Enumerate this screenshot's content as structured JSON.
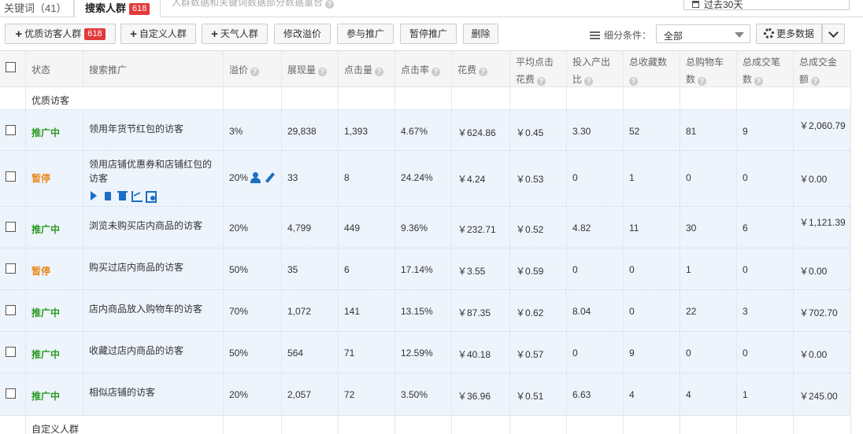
{
  "tabs": {
    "keywords": "关键词（41）",
    "crowd": "搜索人群",
    "crowd_badge": "618",
    "note": "人群数据和关键词数据部分数据重合",
    "date_range": "过去30天"
  },
  "toolbar": {
    "btn_quality": "优质访客人群",
    "btn_quality_badge": "618",
    "btn_custom": "自定义人群",
    "btn_weather": "天气人群",
    "btn_modify_premium": "修改溢价",
    "btn_join": "参与推广",
    "btn_pause": "暂停推广",
    "btn_delete": "删除",
    "filter_label": "细分条件：",
    "filter_value": "全部",
    "more_data": "更多数据"
  },
  "headers": {
    "status": "状态",
    "name": "搜索推广",
    "premium": "溢价",
    "impressions": "展现量",
    "clicks": "点击量",
    "ctr": "点击率",
    "cost": "花费",
    "avg_cpc_1": "平均点击",
    "avg_cpc_2": "花费",
    "roi_1": "投入产出",
    "roi_2": "比",
    "fav_1": "总收藏数",
    "cart_1": "总购物车",
    "cart_2": "数",
    "deals_1": "总成交笔",
    "deals_2": "数",
    "amount_1": "总成交金",
    "amount_2": "额"
  },
  "groups": {
    "quality": "优质访客",
    "custom": "自定义人群"
  },
  "rows": [
    {
      "status": "推广中",
      "name": "领用年货节红包的访客",
      "premium": "3%",
      "impressions": "29,838",
      "clicks": "1,393",
      "ctr": "4.67%",
      "cost": "￥624.86",
      "cpc": "￥0.45",
      "roi": "3.30",
      "fav": "52",
      "cart": "81",
      "deals": "9",
      "amount": "￥2,060.79"
    },
    {
      "status": "暂停",
      "name": "领用店铺优惠券和店铺红包的访客",
      "premium": "20%",
      "impressions": "33",
      "clicks": "8",
      "ctr": "24.24%",
      "cost": "￥4.24",
      "cpc": "￥0.53",
      "roi": "0",
      "fav": "1",
      "cart": "0",
      "deals": "0",
      "amount": "￥0.00"
    },
    {
      "status": "推广中",
      "name": "浏览未购买店内商品的访客",
      "premium": "20%",
      "impressions": "4,799",
      "clicks": "449",
      "ctr": "9.36%",
      "cost": "￥232.71",
      "cpc": "￥0.52",
      "roi": "4.82",
      "fav": "11",
      "cart": "30",
      "deals": "6",
      "amount": "￥1,121.39"
    },
    {
      "status": "暂停",
      "name": "购买过店内商品的访客",
      "premium": "50%",
      "impressions": "35",
      "clicks": "6",
      "ctr": "17.14%",
      "cost": "￥3.55",
      "cpc": "￥0.59",
      "roi": "0",
      "fav": "0",
      "cart": "1",
      "deals": "0",
      "amount": "￥0.00"
    },
    {
      "status": "推广中",
      "name": "店内商品放入购物车的访客",
      "premium": "70%",
      "impressions": "1,072",
      "clicks": "141",
      "ctr": "13.15%",
      "cost": "￥87.35",
      "cpc": "￥0.62",
      "roi": "8.04",
      "fav": "0",
      "cart": "22",
      "deals": "3",
      "amount": "￥702.70"
    },
    {
      "status": "推广中",
      "name": "收藏过店内商品的访客",
      "premium": "50%",
      "impressions": "564",
      "clicks": "71",
      "ctr": "12.59%",
      "cost": "￥40.18",
      "cpc": "￥0.57",
      "roi": "0",
      "fav": "9",
      "cart": "0",
      "deals": "0",
      "amount": "￥0.00"
    },
    {
      "status": "推广中",
      "name": "相似店铺的访客",
      "premium": "20%",
      "impressions": "2,057",
      "clicks": "72",
      "ctr": "3.50%",
      "cost": "￥36.96",
      "cpc": "￥0.51",
      "roi": "6.63",
      "fav": "4",
      "cart": "4",
      "deals": "1",
      "amount": "￥245.00"
    }
  ],
  "colors": {
    "status_on": "#2a9a22",
    "status_off": "#e8891c",
    "badge": "#e4393c",
    "row_bg": "#eef4fc",
    "icon_blue": "#1b6ec6"
  }
}
